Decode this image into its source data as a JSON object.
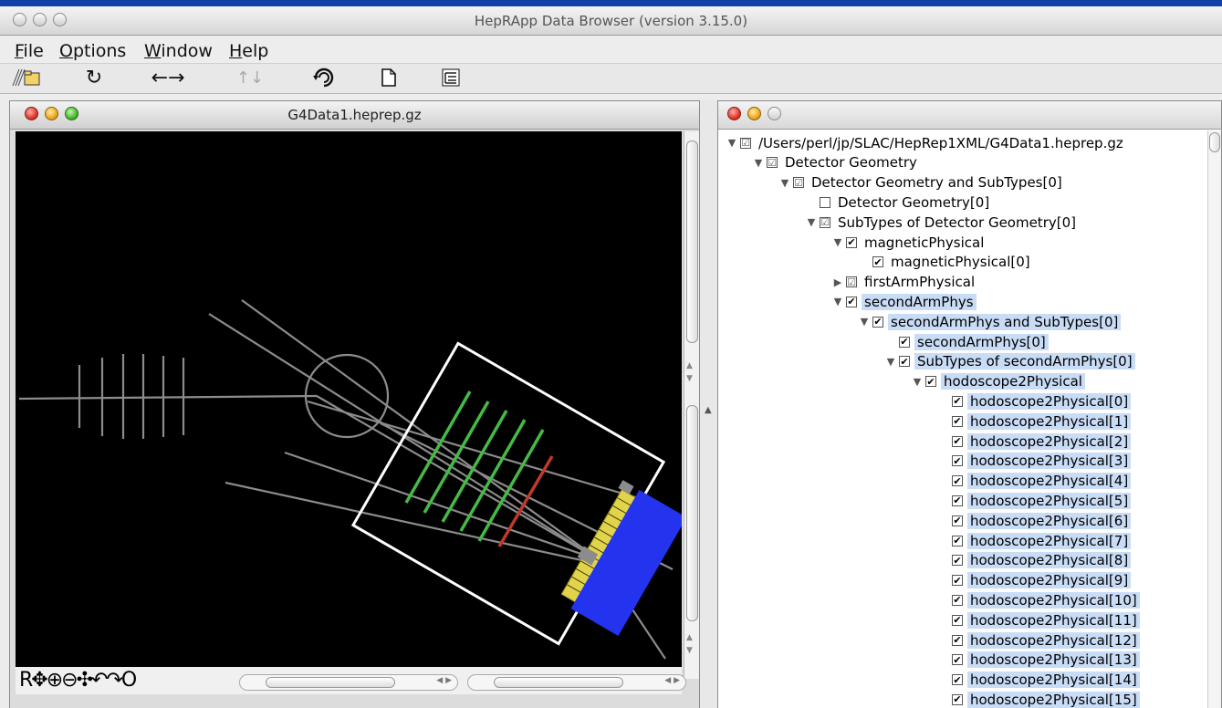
{
  "app": {
    "title": "HepRApp Data Browser (version 3.15.0)"
  },
  "menus": [
    {
      "label": "File",
      "underline": "F",
      "rest": "ile"
    },
    {
      "label": "Options",
      "underline": "O",
      "rest": "ptions"
    },
    {
      "label": "Window",
      "underline": "W",
      "rest": "indow"
    },
    {
      "label": "Help",
      "underline": "H",
      "rest": "elp"
    }
  ],
  "toolbar": {
    "open_icon": "open-folder-icon",
    "refresh_icon": "refresh-icon",
    "swap_h_icon": "swap-horizontal-icon",
    "swap_v_icon": "swap-vertical-icon",
    "rotate_icon": "rotate-view-icon",
    "new_page_icon": "new-page-icon",
    "tree_icon": "tree-icon"
  },
  "viewer": {
    "title": "G4Data1.heprep.gz",
    "nav_tools": "R✥⊕⊖✣↶↷O",
    "colors": {
      "background": "#000000",
      "geometry": "#8c8c8c",
      "hodoscope": "#44bb44",
      "calorimeter_box": "#ffffff",
      "tracker": "#2433ee",
      "chamber": "#e2d44a",
      "red_strip": "#c03a2a"
    }
  },
  "tree": {
    "nodes": [
      {
        "depth": 0,
        "expanded": true,
        "check": "grey",
        "label": "/Users/perl/jp/SLAC/HepRep1XML/G4Data1.heprep.gz",
        "selected": false
      },
      {
        "depth": 1,
        "expanded": true,
        "check": "grey",
        "label": "Detector Geometry",
        "selected": false
      },
      {
        "depth": 2,
        "expanded": true,
        "check": "grey",
        "label": "Detector Geometry and SubTypes[0]",
        "selected": false
      },
      {
        "depth": 3,
        "expanded": null,
        "check": "empty",
        "label": "Detector Geometry[0]",
        "selected": false
      },
      {
        "depth": 3,
        "expanded": true,
        "check": "grey",
        "label": "SubTypes of Detector Geometry[0]",
        "selected": false
      },
      {
        "depth": 4,
        "expanded": true,
        "check": "checked",
        "label": "magneticPhysical",
        "selected": false
      },
      {
        "depth": 5,
        "expanded": null,
        "check": "checked",
        "label": "magneticPhysical[0]",
        "selected": false
      },
      {
        "depth": 4,
        "expanded": false,
        "check": "grey",
        "label": "firstArmPhysical",
        "selected": false
      },
      {
        "depth": 4,
        "expanded": true,
        "check": "checked",
        "label": "secondArmPhys",
        "selected": true
      },
      {
        "depth": 5,
        "expanded": true,
        "check": "checked",
        "label": "secondArmPhys and SubTypes[0]",
        "selected": true
      },
      {
        "depth": 6,
        "expanded": null,
        "check": "checked",
        "label": "secondArmPhys[0]",
        "selected": true
      },
      {
        "depth": 6,
        "expanded": true,
        "check": "checked",
        "label": "SubTypes of secondArmPhys[0]",
        "selected": true
      },
      {
        "depth": 7,
        "expanded": true,
        "check": "checked",
        "label": "hodoscope2Physical",
        "selected": true
      },
      {
        "depth": 8,
        "expanded": null,
        "check": "checked",
        "label": "hodoscope2Physical[0]",
        "selected": true
      },
      {
        "depth": 8,
        "expanded": null,
        "check": "checked",
        "label": "hodoscope2Physical[1]",
        "selected": true
      },
      {
        "depth": 8,
        "expanded": null,
        "check": "checked",
        "label": "hodoscope2Physical[2]",
        "selected": true
      },
      {
        "depth": 8,
        "expanded": null,
        "check": "checked",
        "label": "hodoscope2Physical[3]",
        "selected": true
      },
      {
        "depth": 8,
        "expanded": null,
        "check": "checked",
        "label": "hodoscope2Physical[4]",
        "selected": true
      },
      {
        "depth": 8,
        "expanded": null,
        "check": "checked",
        "label": "hodoscope2Physical[5]",
        "selected": true
      },
      {
        "depth": 8,
        "expanded": null,
        "check": "checked",
        "label": "hodoscope2Physical[6]",
        "selected": true
      },
      {
        "depth": 8,
        "expanded": null,
        "check": "checked",
        "label": "hodoscope2Physical[7]",
        "selected": true
      },
      {
        "depth": 8,
        "expanded": null,
        "check": "checked",
        "label": "hodoscope2Physical[8]",
        "selected": true
      },
      {
        "depth": 8,
        "expanded": null,
        "check": "checked",
        "label": "hodoscope2Physical[9]",
        "selected": true
      },
      {
        "depth": 8,
        "expanded": null,
        "check": "checked",
        "label": "hodoscope2Physical[10]",
        "selected": true
      },
      {
        "depth": 8,
        "expanded": null,
        "check": "checked",
        "label": "hodoscope2Physical[11]",
        "selected": true
      },
      {
        "depth": 8,
        "expanded": null,
        "check": "checked",
        "label": "hodoscope2Physical[12]",
        "selected": true
      },
      {
        "depth": 8,
        "expanded": null,
        "check": "checked",
        "label": "hodoscope2Physical[13]",
        "selected": true
      },
      {
        "depth": 8,
        "expanded": null,
        "check": "checked",
        "label": "hodoscope2Physical[14]",
        "selected": true
      },
      {
        "depth": 8,
        "expanded": null,
        "check": "checked",
        "label": "hodoscope2Physical[15]",
        "selected": true
      }
    ]
  }
}
